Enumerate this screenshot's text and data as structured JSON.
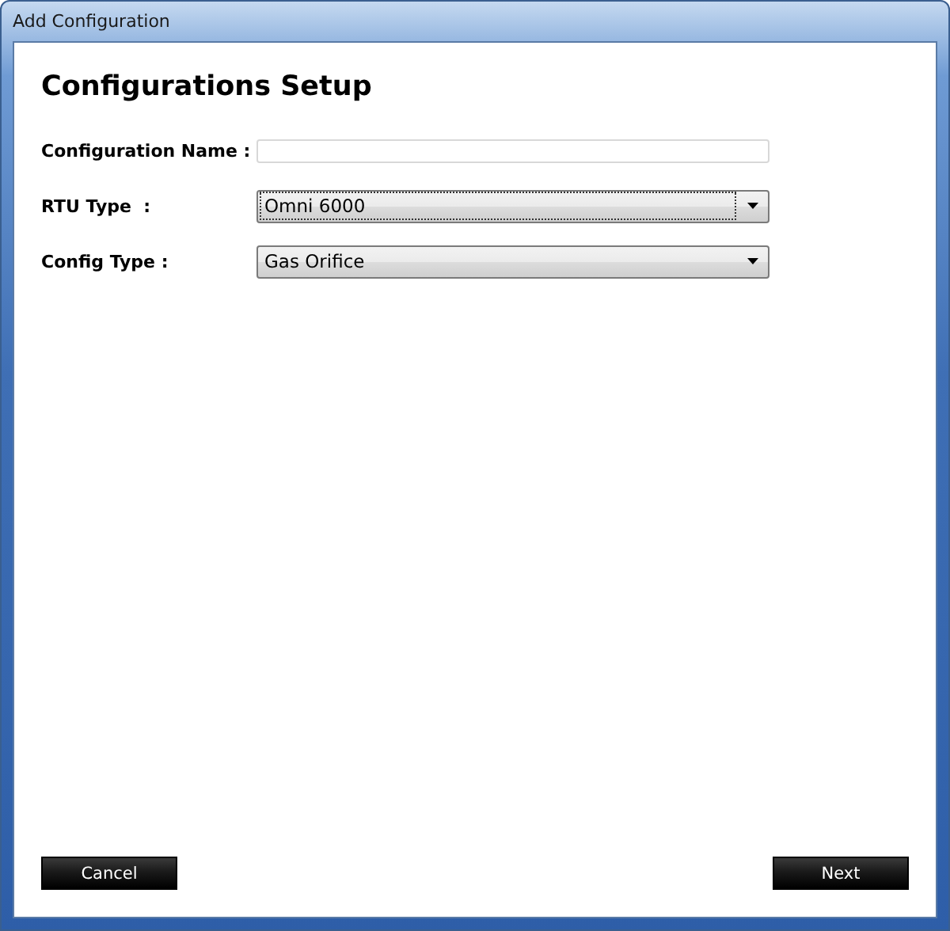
{
  "window": {
    "title": "Add Configuration"
  },
  "heading": "Configurations Setup",
  "fields": [
    {
      "kind": "text",
      "label": "Configuration Name :",
      "focused": false
    },
    {
      "kind": "select",
      "label": "RTU Type  :",
      "value": "Omni 6000",
      "focused": true
    },
    {
      "kind": "select",
      "label": "Config Type :",
      "value": "Gas Orifice",
      "focused": false
    }
  ],
  "buttons": [
    {
      "label": "Cancel"
    },
    {
      "label": "Next"
    }
  ]
}
